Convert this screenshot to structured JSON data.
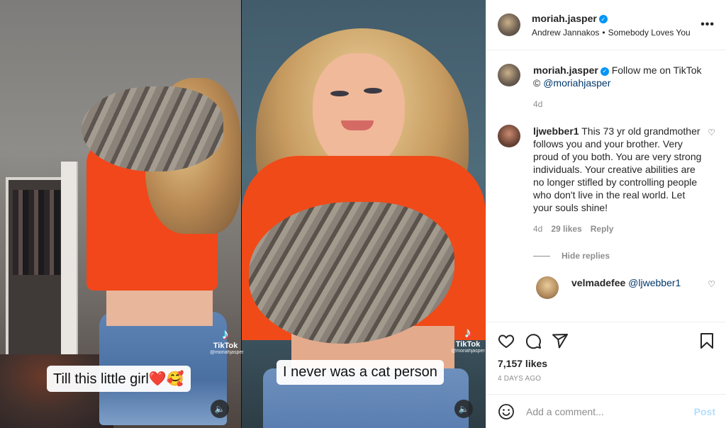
{
  "header": {
    "username": "moriah.jasper",
    "audio_artist": "Andrew Jannakos",
    "separator": "•",
    "audio_title": "Somebody Loves You",
    "more_label": "•••"
  },
  "media": {
    "left_caption": "Till this little girl❤️🥰",
    "right_caption": "I never was a cat person",
    "tiktok_label": "TikTok",
    "tiktok_handle": "@moriahjasper",
    "audio_icon": "speaker-icon"
  },
  "caption": {
    "username": "moriah.jasper",
    "text": "Follow me on TikTok",
    "copyright": "©",
    "mention": "@moriahjasper",
    "time": "4d"
  },
  "comments": [
    {
      "username": "ljwebber1",
      "text": "This 73 yr old grandmother follows you and your brother. Very proud of you both. You are very strong individuals. Your creative abilities are no longer stifled by controlling people who don't live in the real world. Let your souls shine!",
      "time": "4d",
      "likes": "29 likes",
      "reply_label": "Reply",
      "hide_replies": "Hide replies"
    }
  ],
  "reply": {
    "username": "velmadefee",
    "mention": "@ljwebber1"
  },
  "actions": {
    "likes": "7,157 likes",
    "ago": "4 DAYS AGO"
  },
  "add_comment": {
    "placeholder": "Add a comment...",
    "post_label": "Post"
  },
  "colors": {
    "accent": "#0095f6",
    "link": "#00376b",
    "muted": "#8e8e8e",
    "post_disabled": "#b2dffc"
  }
}
